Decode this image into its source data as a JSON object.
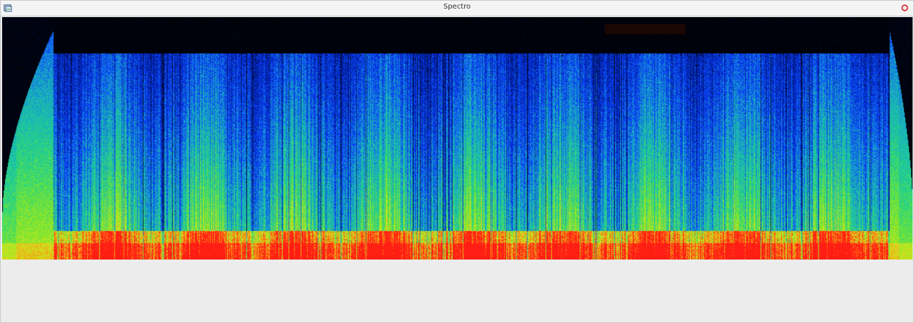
{
  "window": {
    "title": "Spectro",
    "app_icon": "window-app-icon",
    "close_icon": "close-circle-icon"
  },
  "spectrogram": {
    "colormap": [
      "#000000",
      "#001a8c",
      "#0a3cff",
      "#19a8c8",
      "#1fd28c",
      "#7ee62a",
      "#d2e61e",
      "#ff8c14",
      "#ff1e14"
    ],
    "background": "#000000",
    "overlay_text": "",
    "frequency_cutoff_fraction": 0.85
  }
}
